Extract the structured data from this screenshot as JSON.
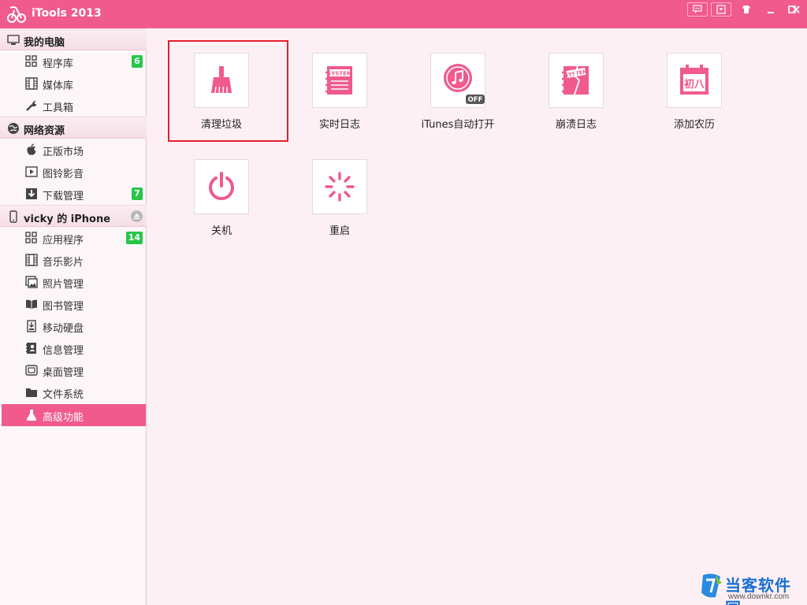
{
  "window": {
    "title": "iTools 2013",
    "accent_color": "#f05a8d",
    "controls": [
      "feedback-icon",
      "menu-dropdown-icon",
      "skin-icon",
      "minimize-icon",
      "maximize-icon",
      "close-icon"
    ]
  },
  "sidebar": {
    "groups": [
      {
        "label": "我的电脑",
        "icon": "computer-icon",
        "items": [
          {
            "label": "程序库",
            "icon": "grid-icon",
            "badge": "6"
          },
          {
            "label": "媒体库",
            "icon": "film-icon"
          },
          {
            "label": "工具箱",
            "icon": "wrench-icon"
          }
        ]
      },
      {
        "label": "网络资源",
        "icon": "globe-icon",
        "items": [
          {
            "label": "正版市场",
            "icon": "apple-icon"
          },
          {
            "label": "图铃影音",
            "icon": "media-icon"
          },
          {
            "label": "下载管理",
            "icon": "download-icon",
            "badge": "7"
          }
        ]
      },
      {
        "label": "vicky 的 iPhone",
        "icon": "phone-icon",
        "items": [
          {
            "label": "应用程序",
            "icon": "grid-icon",
            "badge": "14"
          },
          {
            "label": "音乐影片",
            "icon": "film-icon"
          },
          {
            "label": "照片管理",
            "icon": "photo-icon"
          },
          {
            "label": "图书管理",
            "icon": "book-icon"
          },
          {
            "label": "移动硬盘",
            "icon": "disk-icon"
          },
          {
            "label": "信息管理",
            "icon": "contacts-icon"
          },
          {
            "label": "桌面管理",
            "icon": "desktop-icon"
          },
          {
            "label": "文件系统",
            "icon": "folder-icon"
          },
          {
            "label": "高级功能",
            "icon": "flask-icon",
            "active": true
          }
        ]
      }
    ]
  },
  "main": {
    "tiles": [
      {
        "label": "清理垃圾",
        "icon": "broom-icon",
        "highlighted": true
      },
      {
        "label": "实时日志",
        "icon": "system-log-icon",
        "icon_text": "SYSTEM"
      },
      {
        "label": "iTunes自动打开",
        "icon": "itunes-icon",
        "toggle": "OFF"
      },
      {
        "label": "崩溃日志",
        "icon": "crash-log-icon",
        "icon_text": "SYSTEM"
      },
      {
        "label": "添加农历",
        "icon": "lunar-calendar-icon",
        "icon_text": "初八"
      },
      {
        "label": "关机",
        "icon": "power-icon"
      },
      {
        "label": "重启",
        "icon": "restart-icon"
      }
    ]
  },
  "watermark": {
    "title": "当客软件园",
    "url": "www.downkr.com"
  }
}
